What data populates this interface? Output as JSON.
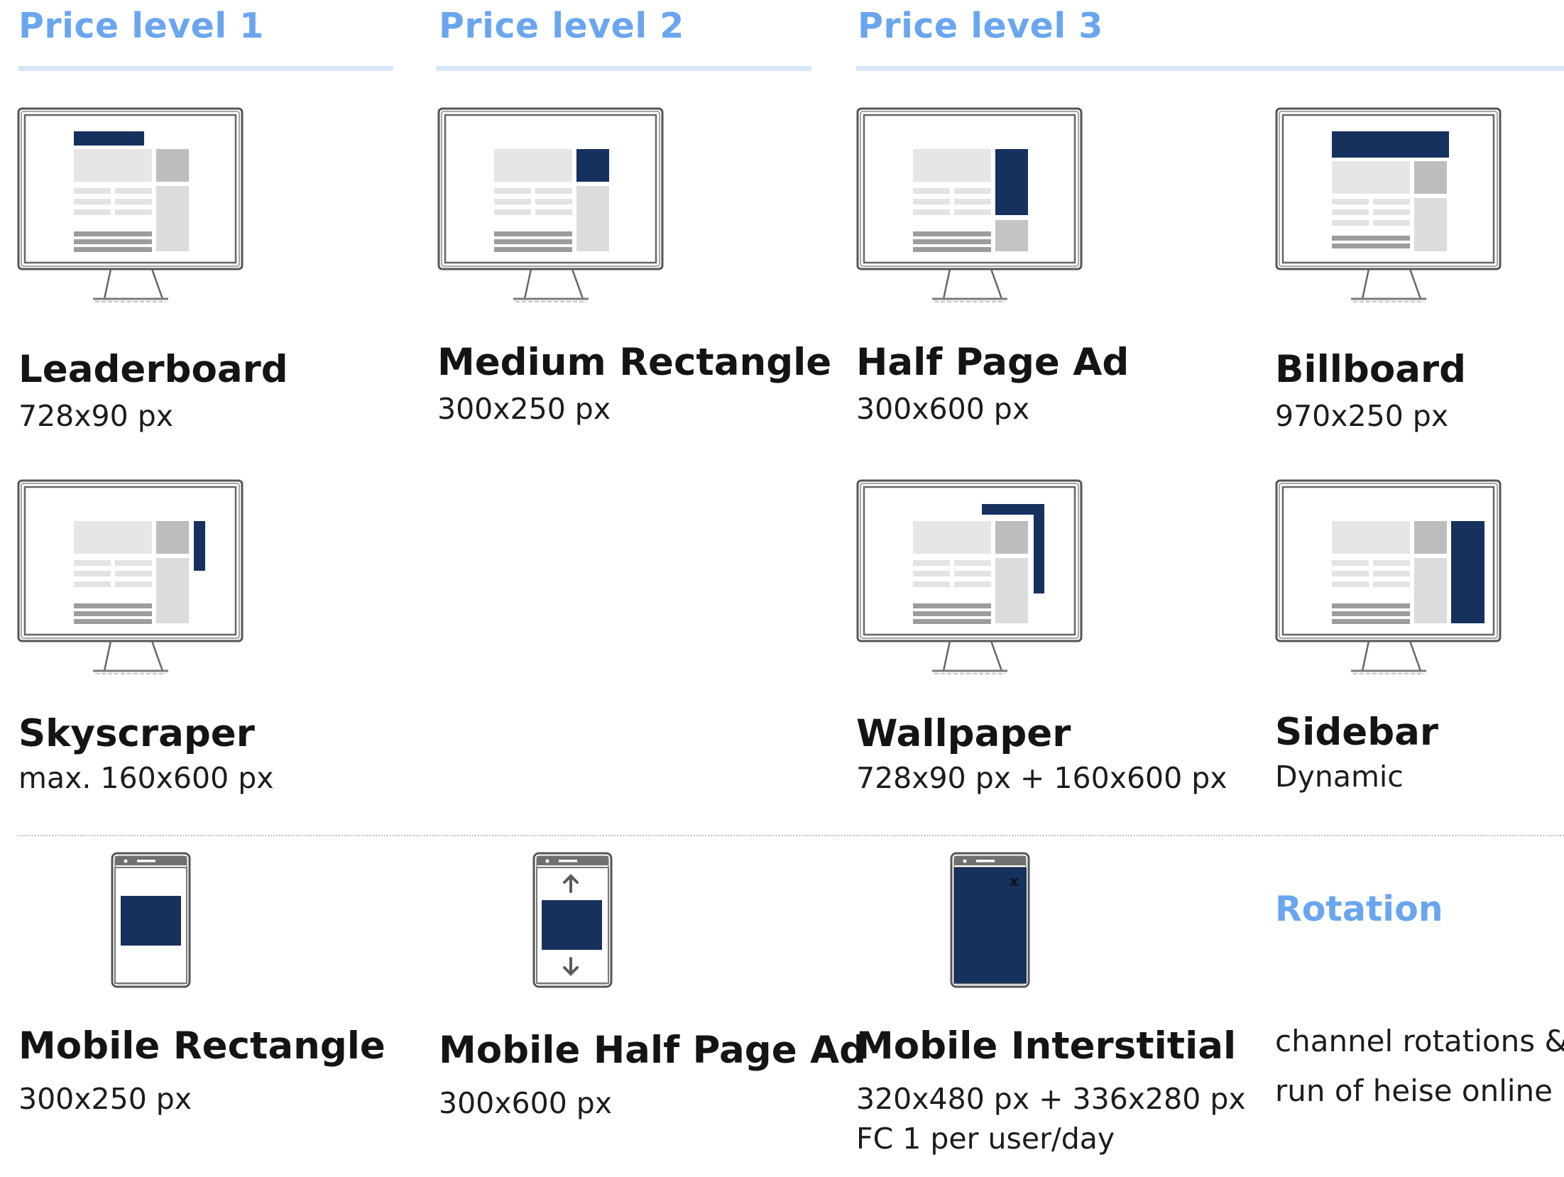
{
  "levels": [
    {
      "title": "Price level 1"
    },
    {
      "title": "Price level 2"
    },
    {
      "title": "Price level 3"
    }
  ],
  "formats": {
    "leaderboard": {
      "name": "Leaderboard",
      "size": "728x90 px"
    },
    "medium_rectangle": {
      "name": "Medium Rectangle",
      "size": "300x250 px"
    },
    "half_page_ad": {
      "name": "Half Page Ad",
      "size": "300x600 px"
    },
    "billboard": {
      "name": "Billboard",
      "size": "970x250 px"
    },
    "skyscraper": {
      "name": "Skyscraper",
      "size": "max. 160x600 px"
    },
    "wallpaper": {
      "name": "Wallpaper",
      "size": "728x90 px + 160x600 px"
    },
    "sidebar": {
      "name": "Sidebar",
      "size": "Dynamic"
    },
    "mobile_rectangle": {
      "name": "Mobile Rectangle",
      "size": "300x250 px"
    },
    "mobile_half_page_ad": {
      "name": "Mobile Half Page Ad",
      "size": "300x600 px"
    },
    "mobile_interstitial": {
      "name": "Mobile Interstitial",
      "size": "320x480 px + 336x280 px",
      "frequency": "FC 1 per user/day"
    }
  },
  "rotation": {
    "title": "Rotation",
    "line1": "channel rotations &",
    "line2": "run of heise online"
  },
  "icons": {
    "desktop": "monitor-icon",
    "mobile": "smartphone-icon",
    "close": "x",
    "arrow_up": "arrow-up-icon",
    "arrow_down": "arrow-down-icon"
  },
  "colors": {
    "accent": "#6aa6ef",
    "ad_highlight": "#16315d",
    "rule": "#d6e6fb",
    "content_light": "#e6e6e6",
    "content_mid": "#bdbdbd",
    "content_dark": "#9c9c9c"
  }
}
